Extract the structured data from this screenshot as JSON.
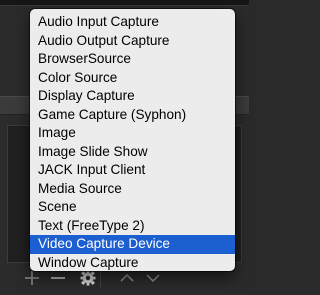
{
  "menu": {
    "items": [
      {
        "label": "Audio Input Capture"
      },
      {
        "label": "Audio Output Capture"
      },
      {
        "label": "BrowserSource"
      },
      {
        "label": "Color Source"
      },
      {
        "label": "Display Capture"
      },
      {
        "label": "Game Capture (Syphon)"
      },
      {
        "label": "Image"
      },
      {
        "label": "Image Slide Show"
      },
      {
        "label": "JACK Input Client"
      },
      {
        "label": "Media Source"
      },
      {
        "label": "Scene"
      },
      {
        "label": "Text (FreeType 2)"
      },
      {
        "label": "Video Capture Device",
        "selected": true
      },
      {
        "label": "Window Capture"
      }
    ],
    "highlight_color": "#1c5fd0"
  },
  "toolbar": {
    "icons": [
      "plus-icon",
      "minus-icon",
      "gear-icon",
      "chevron-up-icon",
      "chevron-down-icon"
    ]
  }
}
